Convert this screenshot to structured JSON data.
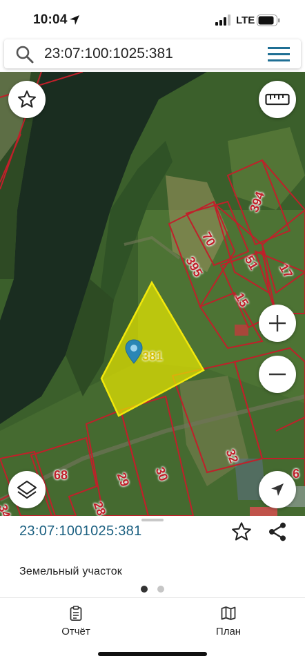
{
  "status_bar": {
    "time": "10:04",
    "network": "LTE",
    "icons": [
      "location-arrow-icon",
      "signal-icon",
      "battery-icon"
    ]
  },
  "search": {
    "value": "23:07:100:1025:381",
    "icon": "search-icon",
    "menu_icon": "hamburger-menu-icon"
  },
  "map": {
    "selected_parcel": "381",
    "parcel_labels": [
      "394",
      "70",
      "395",
      "51",
      "17",
      "15",
      "68",
      "29",
      "30",
      "32",
      "28",
      "6",
      "34"
    ],
    "buttons": [
      "favorites-star-icon",
      "ruler-icon",
      "zoom-in-icon",
      "zoom-out-icon",
      "layers-icon",
      "my-location-icon"
    ],
    "colors": {
      "parcel_border": "#c0202a",
      "selected_fill": "#e6e600",
      "pin": "#2a86b5"
    }
  },
  "sheet": {
    "cadastral_number": "23:07:1001025:381",
    "type": "Земельный участок",
    "page_count": 2,
    "active_page": 1
  },
  "tabs": [
    {
      "label": "Отчёт",
      "icon": "report-clipboard-icon"
    },
    {
      "label": "План",
      "icon": "plan-map-icon"
    }
  ]
}
